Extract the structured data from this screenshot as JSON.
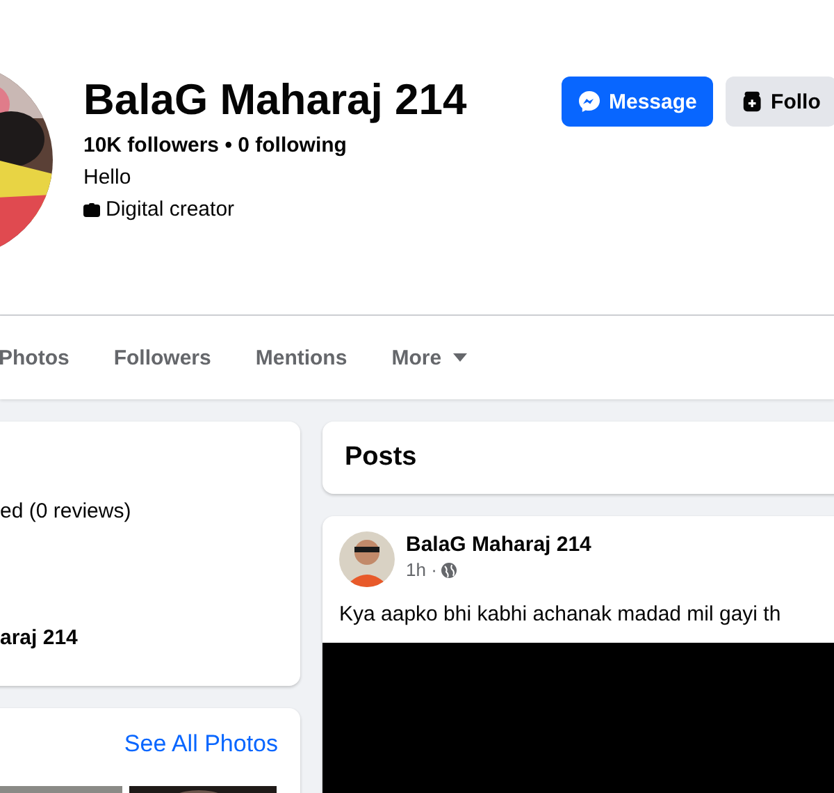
{
  "profile": {
    "name": "BalaG Maharaj 214",
    "stats": "10K followers • 0 following",
    "bio": "Hello",
    "category": "Digital creator"
  },
  "actions": [
    {
      "label": "Message",
      "kind": "primary"
    },
    {
      "label": "Follo",
      "kind": "secondary"
    }
  ],
  "tabs": [
    {
      "label": "Photos",
      "selected": false
    },
    {
      "label": "Followers",
      "selected": false
    },
    {
      "label": "Mentions",
      "selected": false
    },
    {
      "label": "More",
      "selected": false,
      "kind": "dropdown"
    }
  ],
  "intro": {
    "rating": "ed (0 reviews)",
    "page_name": "araj 214"
  },
  "photos": {
    "link": "See All Photos"
  },
  "posts_header": "Posts",
  "post": {
    "author": "BalaG Maharaj 214",
    "time": "1h ·",
    "text": "Kya aapko bhi kabhi achanak madad mil gayi th"
  }
}
